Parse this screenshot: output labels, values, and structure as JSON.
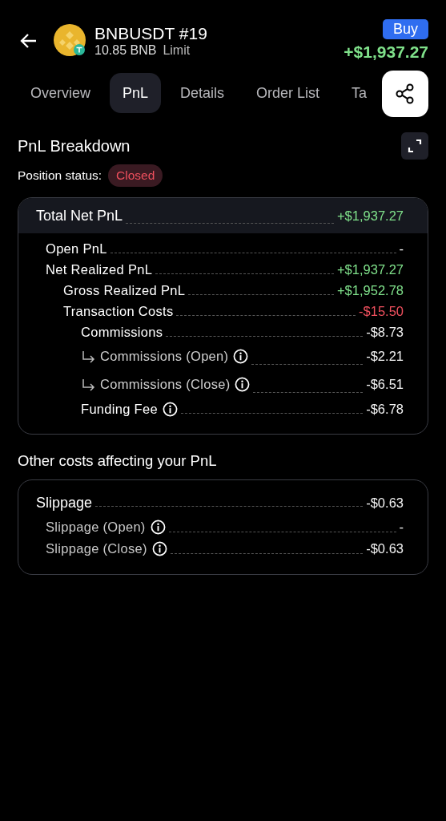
{
  "header": {
    "symbol": "BNBUSDT #19",
    "quantity": "10.85 BNB",
    "order_type": "Limit",
    "side": "Buy",
    "pnl": "+$1,937.27"
  },
  "tabs": [
    {
      "label": "Overview",
      "selected": false
    },
    {
      "label": "PnL",
      "selected": true
    },
    {
      "label": "Details",
      "selected": false
    },
    {
      "label": "Order List",
      "selected": false
    },
    {
      "label": "Ta",
      "selected": false
    }
  ],
  "breakdown": {
    "title": "PnL Breakdown",
    "status_label": "Position status:",
    "status": "Closed",
    "total": {
      "label": "Total Net PnL",
      "value": "+$1,937.27",
      "color": "#7fe08a"
    },
    "rows": [
      {
        "kind": "line",
        "label": "Open PnL",
        "value": "-",
        "color": "#f2f2f2",
        "info": false
      },
      {
        "kind": "line",
        "label": "Net Realized PnL",
        "value": "+$1,937.27",
        "color": "#7fe08a",
        "info": false,
        "children": [
          {
            "kind": "line",
            "label": "Gross Realized PnL",
            "value": "+$1,952.78",
            "color": "#7fe08a",
            "info": false
          },
          {
            "kind": "line",
            "label": "Transaction Costs",
            "value": "-$15.50",
            "color": "#f0505e",
            "info": false,
            "children": [
              {
                "kind": "line",
                "label": "Commissions",
                "value": "-$8.73",
                "color": "#f2f2f2",
                "info": false
              },
              {
                "kind": "branch",
                "label": "Commissions (Open)",
                "value": "-$2.21",
                "color": "#f2f2f2",
                "info": true
              },
              {
                "kind": "branch",
                "label": "Commissions (Close)",
                "value": "-$6.51",
                "color": "#f2f2f2",
                "info": true
              },
              {
                "kind": "line",
                "label": "Funding Fee",
                "value": "-$6.78",
                "color": "#f2f2f2",
                "info": true
              }
            ]
          }
        ]
      }
    ]
  },
  "other_costs": {
    "title": "Other costs affecting your PnL",
    "total": {
      "label": "Slippage",
      "value": "-$0.63",
      "color": "#f2f2f2"
    },
    "rows": [
      {
        "kind": "dim",
        "label": "Slippage (Open)",
        "value": "-",
        "color": "#f2f2f2",
        "info": true
      },
      {
        "kind": "dim",
        "label": "Slippage (Close)",
        "value": "-$0.63",
        "color": "#f2f2f2",
        "info": true
      }
    ]
  }
}
